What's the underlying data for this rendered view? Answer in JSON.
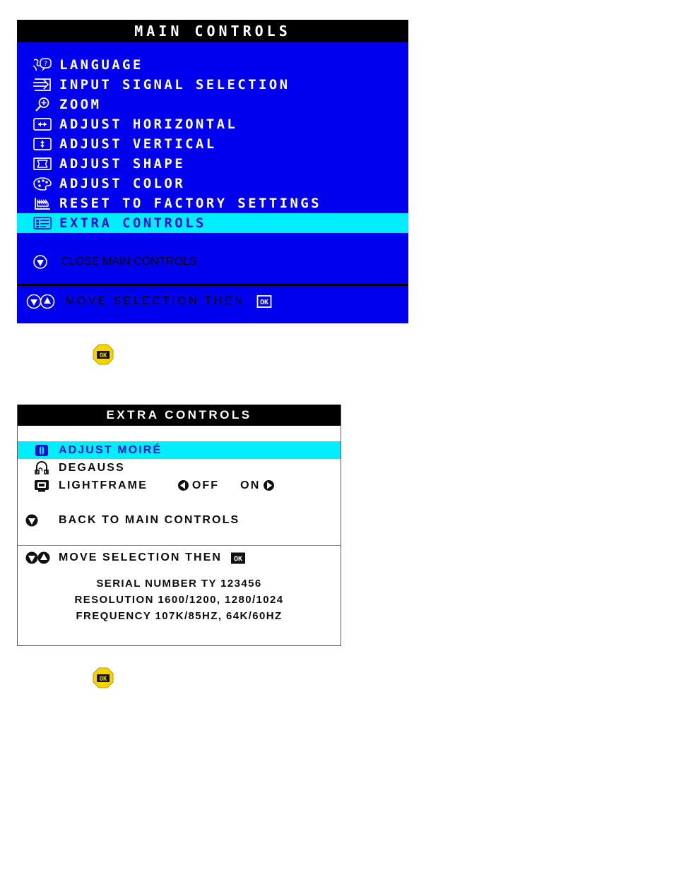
{
  "main_controls": {
    "title": "MAIN CONTROLS",
    "items": [
      {
        "label": "LANGUAGE",
        "icon": "language-icon",
        "selected": false
      },
      {
        "label": "INPUT SIGNAL SELECTION",
        "icon": "input-signal-icon",
        "selected": false
      },
      {
        "label": "ZOOM",
        "icon": "zoom-magnifier-icon",
        "selected": false
      },
      {
        "label": "ADJUST HORIZONTAL",
        "icon": "horizontal-arrows-icon",
        "selected": false
      },
      {
        "label": "ADJUST VERTICAL",
        "icon": "vertical-arrows-icon",
        "selected": false
      },
      {
        "label": "ADJUST SHAPE",
        "icon": "shape-pincushion-icon",
        "selected": false
      },
      {
        "label": "ADJUST COLOR",
        "icon": "color-palette-icon",
        "selected": false
      },
      {
        "label": "RESET TO FACTORY SETTINGS",
        "icon": "factory-reset-icon",
        "selected": false
      },
      {
        "label": "EXTRA CONTROLS",
        "icon": "extra-controls-icon",
        "selected": true
      }
    ],
    "close_label": "CLOSE MAIN CONTROLS",
    "close_icon": "down-triangle-icon",
    "footer_label": "MOVE SELECTION THEN",
    "footer_icons": "down-up-triangle-icons",
    "footer_ok_icon": "ok-key-icon"
  },
  "extra_controls": {
    "title": "EXTRA CONTROLS",
    "items": [
      {
        "label": "ADJUST MOIRÉ",
        "icon": "moire-icon",
        "selected": true
      },
      {
        "label": "DEGAUSS",
        "icon": "degauss-icon",
        "selected": false
      },
      {
        "label": "LIGHTFRAME",
        "icon": "lightframe-icon",
        "selected": false
      }
    ],
    "lightframe": {
      "left_arrow_icon": "left-arrow-icon",
      "off_label": "OFF",
      "on_label": "ON",
      "right_arrow_icon": "right-arrow-icon"
    },
    "back_label": "BACK TO MAIN CONTROLS",
    "back_icon": "down-triangle-icon",
    "move_label": "MOVE SELECTION THEN",
    "move_icons": "down-up-triangle-icons",
    "move_ok_icon": "ok-key-icon",
    "info_lines": [
      "SERIAL NUMBER TY 123456",
      "RESOLUTION 1600/1200, 1280/1024",
      "FREQUENCY 107K/85HZ, 64K/60HZ"
    ]
  },
  "ok_badges": [
    {
      "label": "OK",
      "icon": "ok-button-badge"
    },
    {
      "label": "OK",
      "icon": "ok-button-badge"
    }
  ],
  "colors": {
    "osd_blue": "#0000ee",
    "osd_cyan_highlight": "#00eeff",
    "osd_title_black": "#000000",
    "osd_white": "#ffffff",
    "badge_yellow": "#f5d400"
  }
}
